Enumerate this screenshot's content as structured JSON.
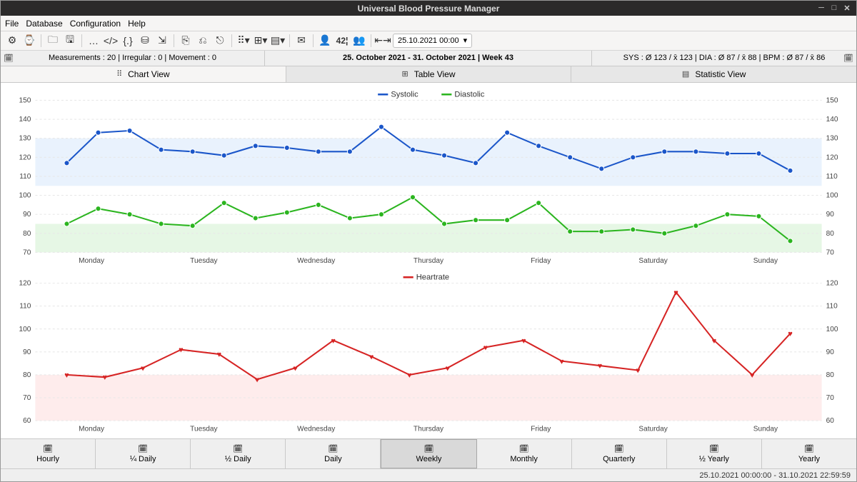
{
  "window": {
    "title": "Universal Blood Pressure Manager"
  },
  "menu": {
    "file": "File",
    "database": "Database",
    "configuration": "Configuration",
    "help": "Help"
  },
  "toolbar": {
    "date_value": "25.10.2021 00:00"
  },
  "infobar": {
    "measurements": "Measurements : 20 | Irregular : 0 | Movement : 0",
    "range": "25. October 2021 - 31. October 2021 | Week 43",
    "stats": "SYS : Ø 123 / x̄ 123 | DIA : Ø 87 / x̄ 88 | BPM : Ø 87 / x̄ 86"
  },
  "tabs": {
    "chart": "Chart View",
    "table": "Table View",
    "statistic": "Statistic View"
  },
  "legend": {
    "systolic": "Systolic",
    "diastolic": "Diastolic",
    "heartrate": "Heartrate"
  },
  "range_buttons": [
    "Hourly",
    "¼ Daily",
    "½ Daily",
    "Daily",
    "Weekly",
    "Monthly",
    "Quarterly",
    "½ Yearly",
    "Yearly"
  ],
  "active_range": "Weekly",
  "statusbar": "25.10.2021 00:00:00 - 31.10.2021 22:59:59",
  "chart_data": [
    {
      "type": "line",
      "title": "",
      "series": [
        {
          "name": "Systolic",
          "color": "#1b56c9",
          "values": [
            117,
            133,
            134,
            124,
            123,
            121,
            126,
            125,
            123,
            123,
            136,
            124,
            121,
            117,
            133,
            126,
            120,
            114,
            120,
            123,
            123,
            122,
            122,
            113
          ]
        },
        {
          "name": "Diastolic",
          "color": "#2bb51f",
          "values": [
            85,
            93,
            90,
            85,
            84,
            96,
            88,
            91,
            95,
            88,
            90,
            99,
            85,
            87,
            87,
            96,
            81,
            81,
            82,
            80,
            84,
            90,
            89,
            76
          ]
        }
      ],
      "ylim": [
        70,
        150
      ],
      "yticks": [
        70,
        80,
        90,
        100,
        110,
        120,
        130,
        140,
        150
      ],
      "x_categories": [
        "Monday",
        "Tuesday",
        "Wednesday",
        "Thursday",
        "Friday",
        "Saturday",
        "Sunday"
      ]
    },
    {
      "type": "line",
      "title": "",
      "series": [
        {
          "name": "Heartrate",
          "color": "#d62424",
          "values": [
            80,
            79,
            83,
            91,
            89,
            78,
            83,
            95,
            88,
            80,
            83,
            92,
            95,
            86,
            84,
            82,
            116,
            95,
            80,
            98
          ]
        }
      ],
      "ylim": [
        60,
        120
      ],
      "yticks": [
        60,
        70,
        80,
        90,
        100,
        110,
        120
      ],
      "x_categories": [
        "Monday",
        "Tuesday",
        "Wednesday",
        "Thursday",
        "Friday",
        "Saturday",
        "Sunday"
      ]
    }
  ]
}
